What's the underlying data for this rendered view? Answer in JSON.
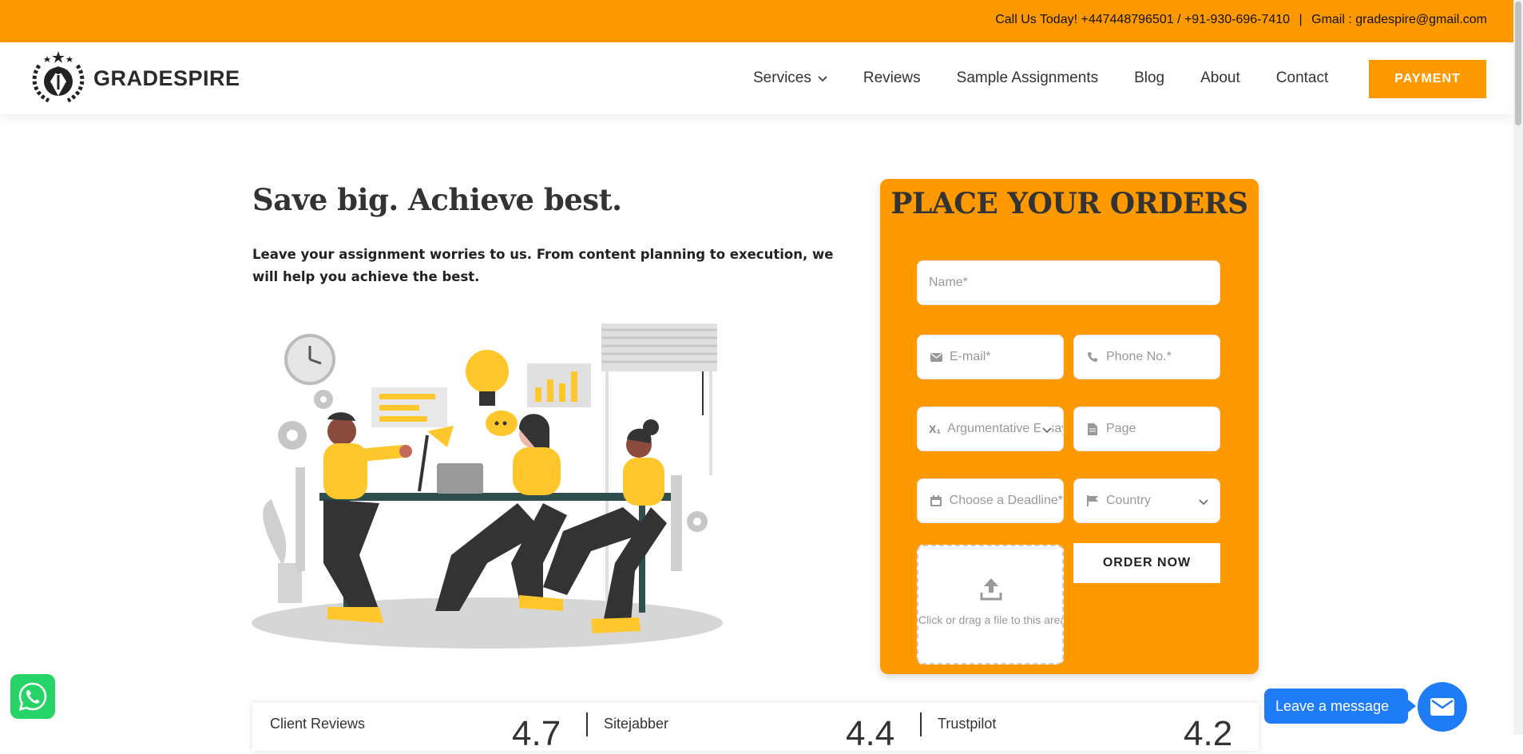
{
  "topbar": {
    "call": "Call Us Today! +447448796501 / +91-930-696-7410",
    "separator": "|",
    "gmail": "Gmail : gradespire@gmail.com"
  },
  "header": {
    "logo_text": "GRADESPIRE",
    "nav": [
      {
        "label": "Services",
        "icon": "chevron-down-icon"
      },
      {
        "label": "Reviews"
      },
      {
        "label": "Sample Assignments"
      },
      {
        "label": "Blog"
      },
      {
        "label": "About"
      },
      {
        "label": "Contact"
      }
    ],
    "payment_label": "PAYMENT"
  },
  "hero": {
    "title": "Save big. Achieve best.",
    "description": "Leave your assignment worries to us. From content planning to execution, we will help you achieve the best."
  },
  "order_form": {
    "title": "PLACE YOUR ORDERS",
    "name_placeholder": "Name*",
    "email_placeholder": "E-mail*",
    "phone_placeholder": "Phone No.*",
    "subject_value": "Argumentative Essay",
    "pages_placeholder": "Page",
    "deadline_placeholder": "Choose a Deadline*",
    "country_placeholder": "Country",
    "upload_text": "Click or drag a file to this area to upload.",
    "order_button": "ORDER NOW"
  },
  "reviews": [
    {
      "name": "Client Reviews",
      "score": "4.7"
    },
    {
      "name": "Sitejabber",
      "score": "4.4"
    },
    {
      "name": "Trustpilot",
      "score": "4.2"
    }
  ],
  "chat": {
    "leave_message": "Leave a message"
  },
  "colors": {
    "accent": "#FF9900",
    "chat_blue": "#1E7CF7",
    "whatsapp_green": "#25D366"
  }
}
